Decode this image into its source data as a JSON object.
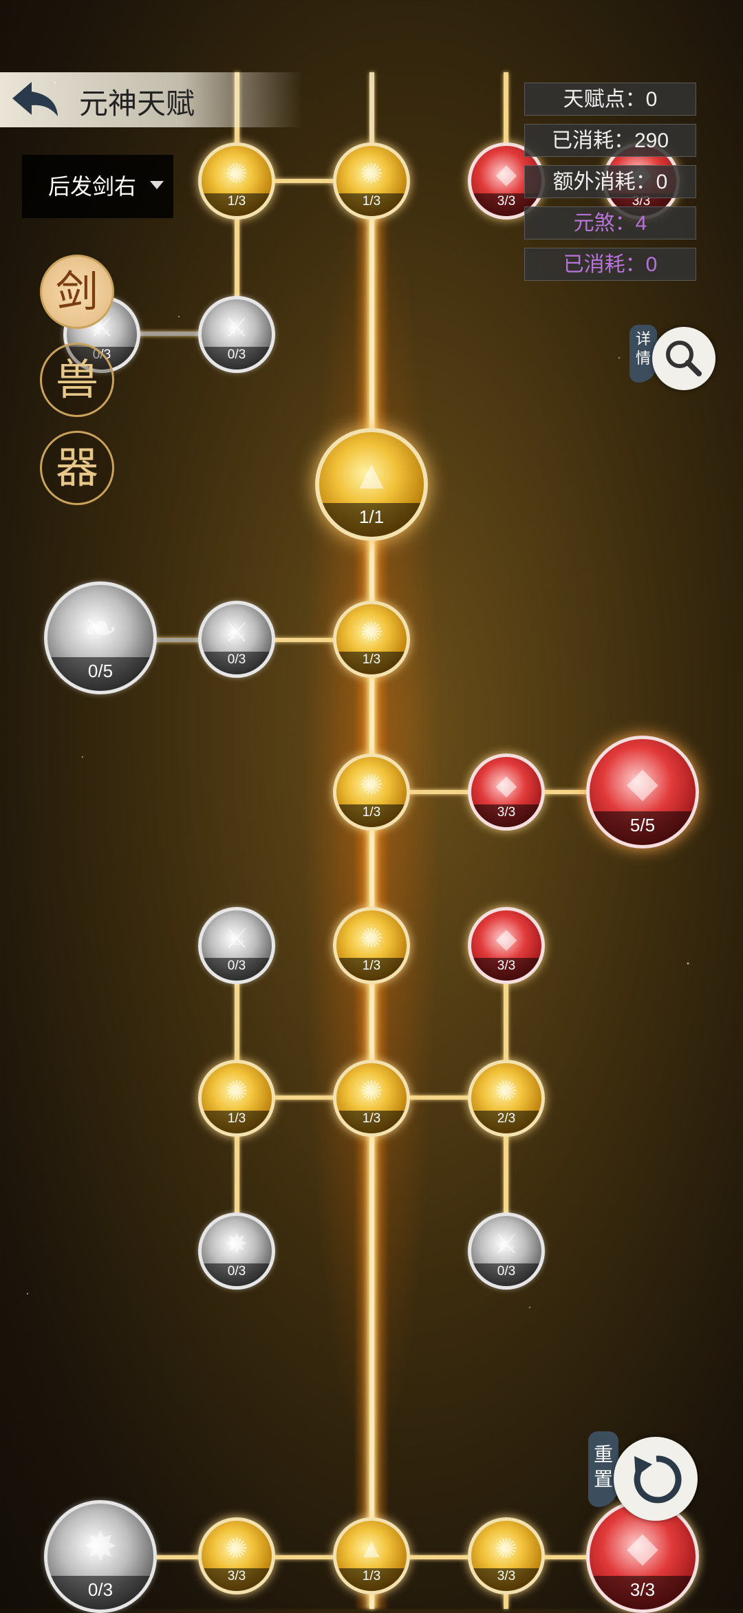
{
  "header": {
    "title": "元神天赋",
    "back_icon": "back-arrow-icon"
  },
  "filter": {
    "selected": "后发剑右"
  },
  "stats": {
    "talent_points": "天赋点：0",
    "consumed": "已消耗：290",
    "extra_consumed": "额外消耗：0",
    "yuansha": "元煞：4",
    "consumed_2": "已消耗：0"
  },
  "categories": [
    "剑",
    "兽",
    "器"
  ],
  "actions": {
    "details_label": "详情",
    "search_icon": "search-icon",
    "reset_label": "重置",
    "reset_icon": "reset-icon"
  },
  "nodes": [
    {
      "id": "r1c1",
      "type": "gold",
      "level": "1/3"
    },
    {
      "id": "r1c2",
      "type": "gold",
      "level": "1/3"
    },
    {
      "id": "r1c3",
      "type": "red",
      "level": "3/3"
    },
    {
      "id": "r1c4",
      "type": "red",
      "level": "3/3"
    },
    {
      "id": "r2c0",
      "type": "gray",
      "level": "0/3"
    },
    {
      "id": "r2c1",
      "type": "gray",
      "level": "0/3"
    },
    {
      "id": "core",
      "type": "gold",
      "level": "1/1"
    },
    {
      "id": "r4big",
      "type": "gray",
      "level": "0/5"
    },
    {
      "id": "r4c1",
      "type": "gray",
      "level": "0/3"
    },
    {
      "id": "r4c2",
      "type": "gold",
      "level": "1/3"
    },
    {
      "id": "r5c2",
      "type": "gold",
      "level": "1/3"
    },
    {
      "id": "r5c3",
      "type": "red",
      "level": "3/3"
    },
    {
      "id": "r5big",
      "type": "red",
      "level": "5/5"
    },
    {
      "id": "r6c1",
      "type": "gray",
      "level": "0/3"
    },
    {
      "id": "r6c2",
      "type": "gold",
      "level": "1/3"
    },
    {
      "id": "r6c3",
      "type": "red",
      "level": "3/3"
    },
    {
      "id": "r7c1",
      "type": "gold",
      "level": "1/3"
    },
    {
      "id": "r7c2",
      "type": "gold",
      "level": "1/3"
    },
    {
      "id": "r7c3",
      "type": "gold",
      "level": "2/3"
    },
    {
      "id": "r8c1",
      "type": "gray",
      "level": "0/3"
    },
    {
      "id": "r8c3",
      "type": "gray",
      "level": "0/3"
    },
    {
      "id": "r9big",
      "type": "gray",
      "level": "0/3"
    },
    {
      "id": "r9c1",
      "type": "gold",
      "level": "3/3"
    },
    {
      "id": "r9c2",
      "type": "gold",
      "level": "1/3"
    },
    {
      "id": "r9c3",
      "type": "gold",
      "level": "3/3"
    },
    {
      "id": "r9c4",
      "type": "red",
      "level": "3/3"
    }
  ]
}
